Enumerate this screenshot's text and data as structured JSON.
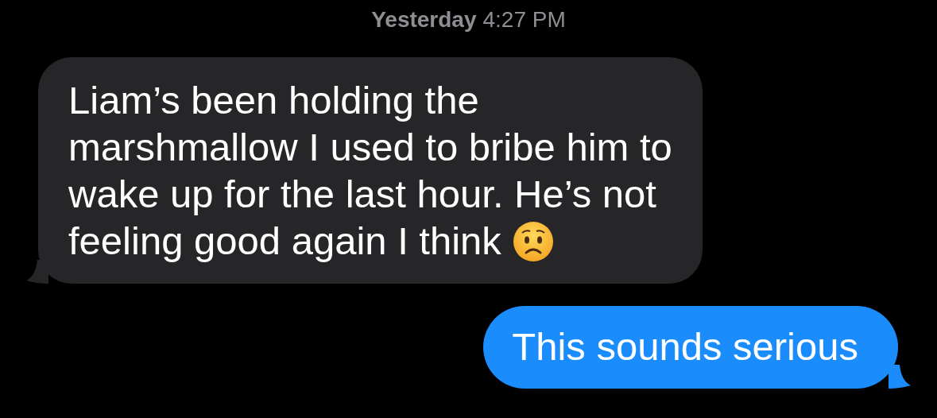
{
  "timestamp": {
    "day": "Yesterday",
    "time": "4:27 PM"
  },
  "messages": [
    {
      "kind": "incoming",
      "text": "Liam’s been holding the marshmallow I used to bribe him to wake up for the last hour. He’s not feeling good again I think",
      "emoji": true
    },
    {
      "kind": "outgoing",
      "text": "This sounds serious",
      "emoji": false
    }
  ]
}
